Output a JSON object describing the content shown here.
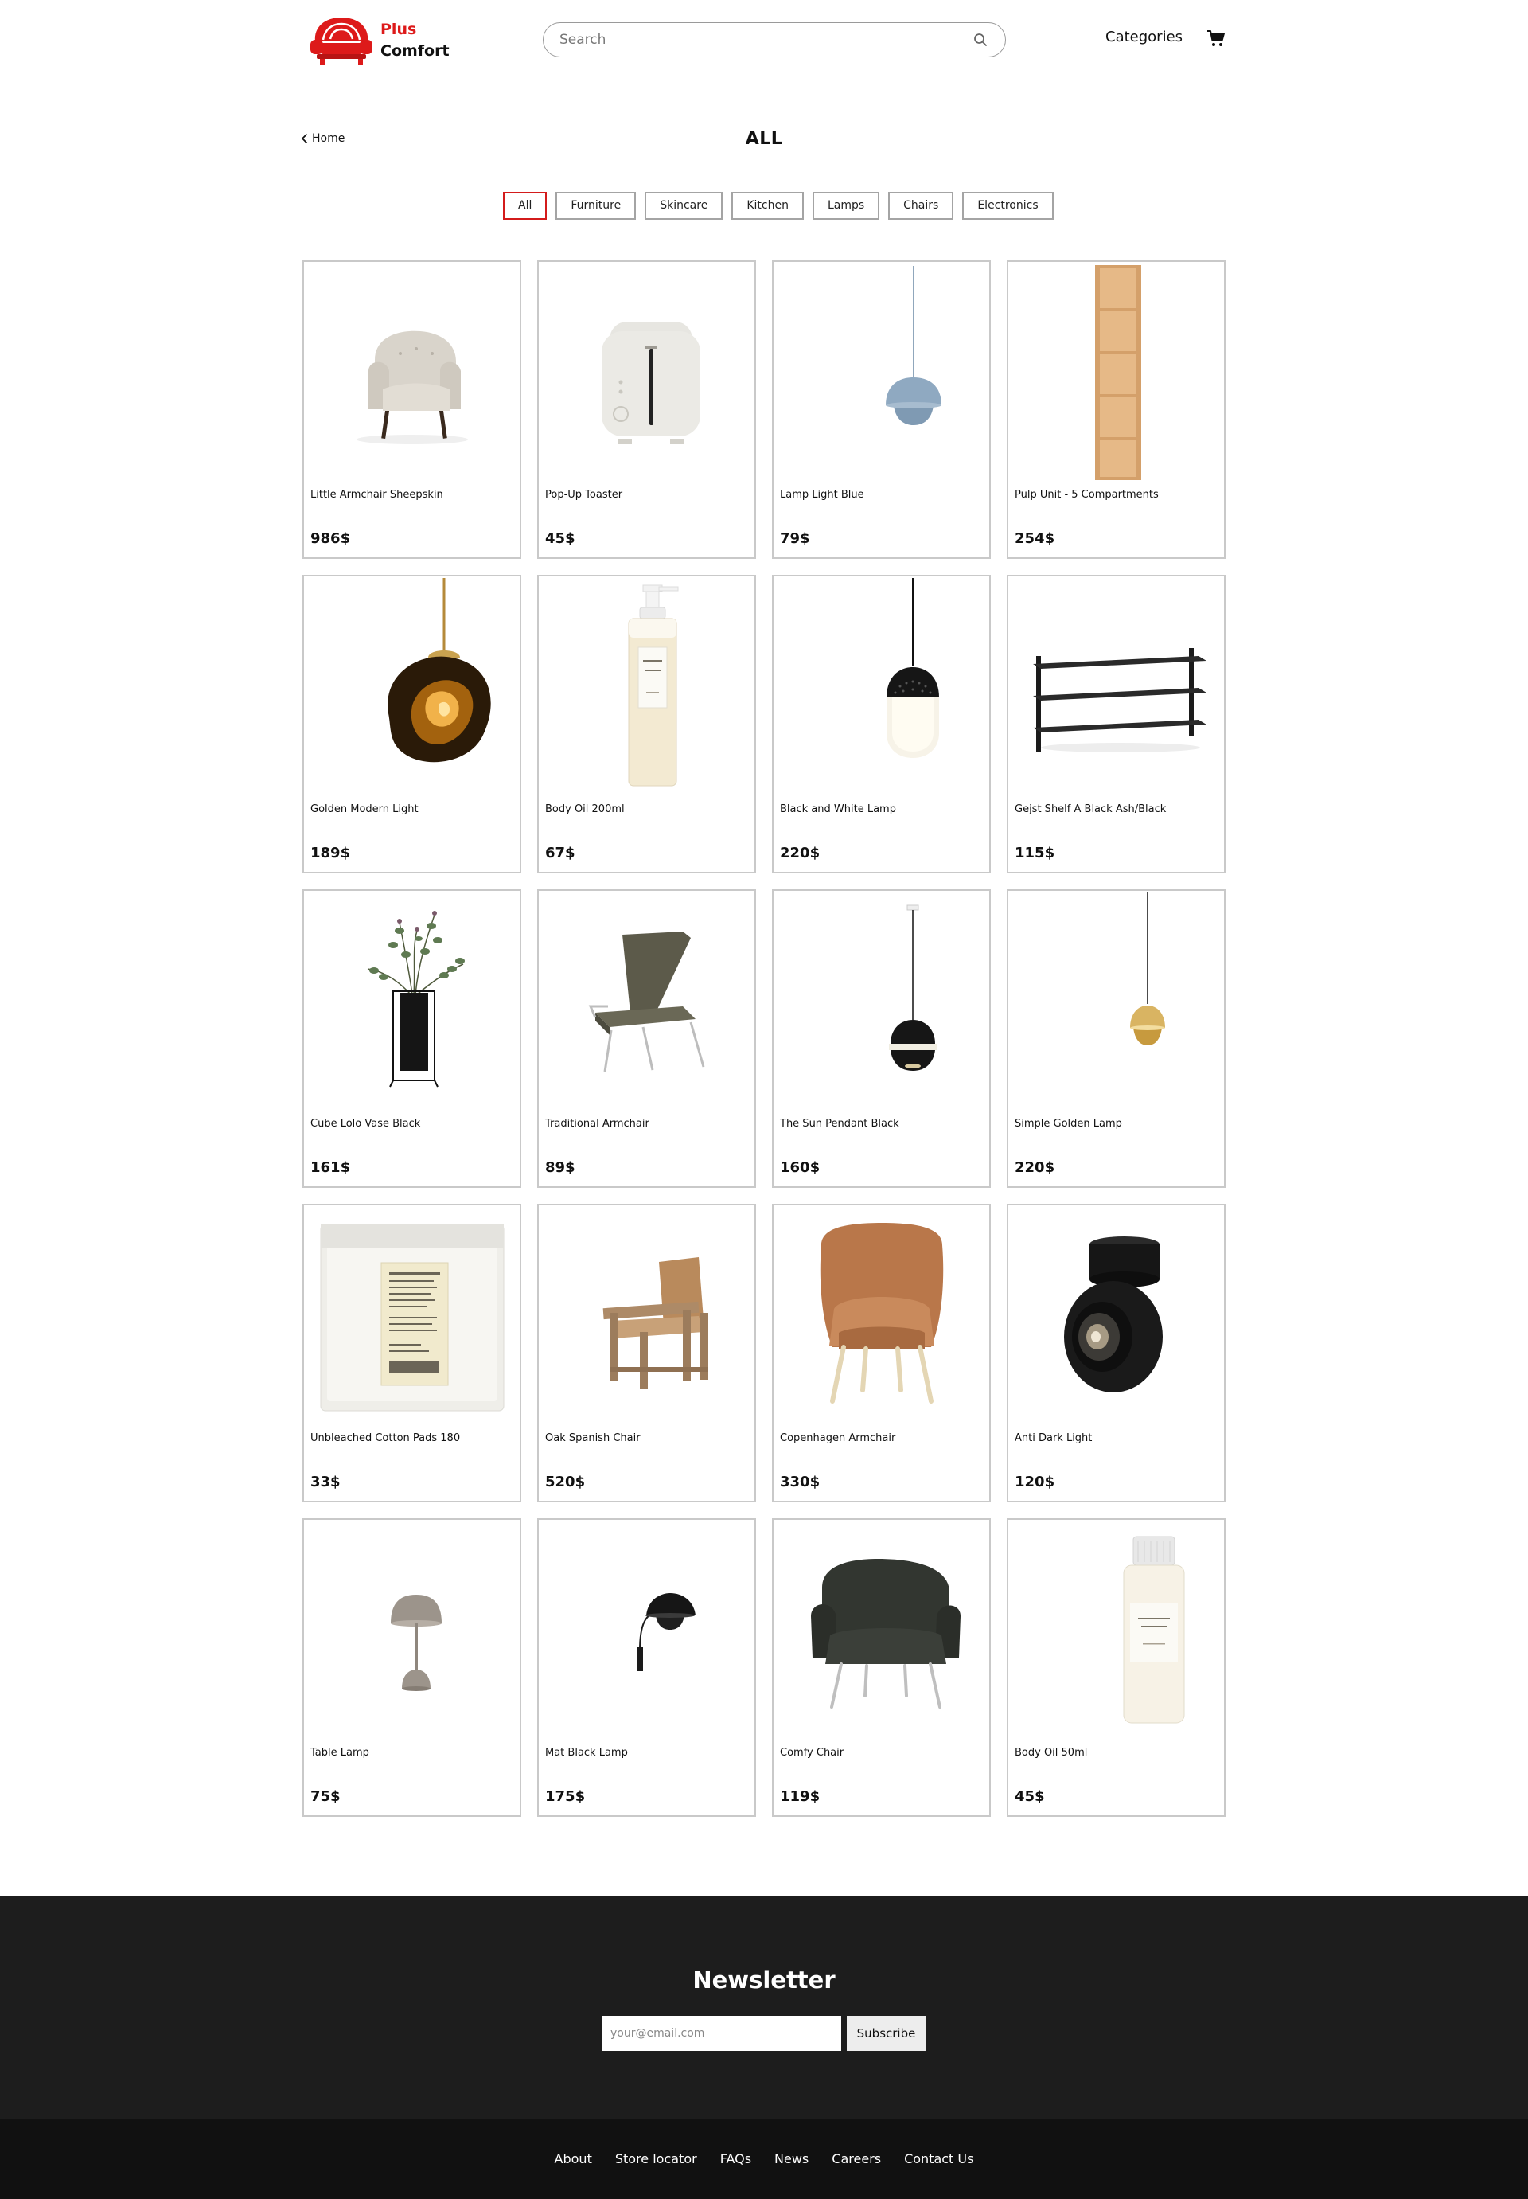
{
  "brand": {
    "name_line1": "Plus",
    "name_line2": "Comfort",
    "accent_color": "#dd1a1a"
  },
  "header": {
    "search_placeholder": "Search",
    "categories_label": "Categories",
    "cart_icon": "cart-icon"
  },
  "page": {
    "back_label": "Home",
    "title": "ALL"
  },
  "filters": [
    {
      "label": "All",
      "active": true
    },
    {
      "label": "Furniture",
      "active": false
    },
    {
      "label": "Skincare",
      "active": false
    },
    {
      "label": "Kitchen",
      "active": false
    },
    {
      "label": "Lamps",
      "active": false
    },
    {
      "label": "Chairs",
      "active": false
    },
    {
      "label": "Electronics",
      "active": false
    }
  ],
  "products": [
    {
      "name": "Little Armchair Sheepskin",
      "price": "986$",
      "image": "armchair-sheepskin"
    },
    {
      "name": "Pop-Up Toaster",
      "price": "45$",
      "image": "toaster"
    },
    {
      "name": "Lamp Light Blue",
      "price": "79$",
      "image": "pendant-blue"
    },
    {
      "name": "Pulp Unit - 5 Compartments",
      "price": "254$",
      "image": "shelf-unit"
    },
    {
      "name": "Golden Modern Light",
      "price": "189$",
      "image": "pendant-golden-melt"
    },
    {
      "name": "Body Oil 200ml",
      "price": "67$",
      "image": "pump-bottle"
    },
    {
      "name": "Black and White Lamp",
      "price": "220$",
      "image": "pendant-black-white"
    },
    {
      "name": "Gejst Shelf A Black Ash/Black",
      "price": "115$",
      "image": "wall-shelf"
    },
    {
      "name": "Cube Lolo Vase Black",
      "price": "161$",
      "image": "vase"
    },
    {
      "name": "Traditional Armchair",
      "price": "89$",
      "image": "lounge-chair"
    },
    {
      "name": "The Sun Pendant Black",
      "price": "160$",
      "image": "pendant-sun"
    },
    {
      "name": "Simple Golden Lamp",
      "price": "220$",
      "image": "pendant-gold"
    },
    {
      "name": "Unbleached Cotton Pads 180",
      "price": "33$",
      "image": "cotton-pads"
    },
    {
      "name": "Oak Spanish Chair",
      "price": "520$",
      "image": "spanish-chair"
    },
    {
      "name": "Copenhagen Armchair",
      "price": "330$",
      "image": "leather-armchair"
    },
    {
      "name": "Anti Dark Light",
      "price": "120$",
      "image": "spotlight"
    },
    {
      "name": "Table Lamp",
      "price": "75$",
      "image": "table-lamp"
    },
    {
      "name": "Mat Black Lamp",
      "price": "175$",
      "image": "wall-lamp"
    },
    {
      "name": "Comfy Chair",
      "price": "119$",
      "image": "comfy-chair"
    },
    {
      "name": "Body Oil 50ml",
      "price": "45$",
      "image": "small-bottle"
    }
  ],
  "newsletter": {
    "title": "Newsletter",
    "input_placeholder": "your@email.com",
    "button_label": "Subscribe"
  },
  "footer": {
    "links": [
      "About",
      "Store locator",
      "FAQs",
      "News",
      "Careers",
      "Contact Us"
    ]
  }
}
